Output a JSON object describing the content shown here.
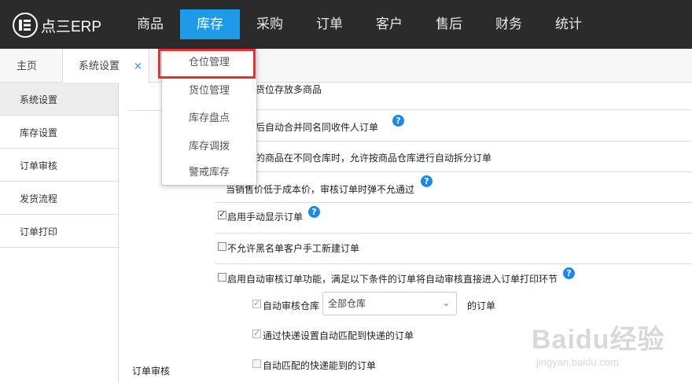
{
  "topbar": {
    "logo_text": "点三ERP",
    "nav": [
      "商品",
      "库存",
      "采购",
      "订单",
      "客户",
      "售后",
      "财务",
      "统计"
    ],
    "active_nav": "库存"
  },
  "tabs": {
    "home": "主页",
    "settings": "系统设置",
    "close": "×"
  },
  "sidebar": {
    "items": [
      "系统设置",
      "库存设置",
      "订单审核",
      "发货流程",
      "订单打印"
    ]
  },
  "dropdown": {
    "items": [
      "仓位管理",
      "货位管理",
      "库存盘点",
      "库存调拨",
      "警戒库存"
    ],
    "highlighted": "仓位管理"
  },
  "settings": {
    "row0": "一货位存放多商品",
    "row1": "裁后自动合并同名同收件人订单",
    "row2": "中的商品在不同仓库时，允许按商品仓库进行自动拆分订单",
    "row3": "当销售价低于成本价，审核订单时弹不允通过",
    "row4": "启用手动显示订单",
    "row5": "不允许黑名单客户手工新建订单",
    "row6": "启用自动审核订单功能，满足以下条件的订单将自动审核直接进入订单打印环节",
    "sub1_label": "自动审核仓库",
    "sub1_select": "全部仓库",
    "sub1_suffix": "的订单",
    "sub2": "通过快递设置自动匹配到快递的订单",
    "sub3": "自动匹配的快递能到的订单",
    "section_label": "订单审核",
    "help_glyph": "?"
  },
  "watermark": {
    "brand": "Baidu经验",
    "sub": "jingyan.baidu.com"
  },
  "colors": {
    "topbar": "#2b2b2b",
    "accent": "#1e9ae8",
    "highlight_border": "#e53030",
    "help": "#1e88e5"
  }
}
